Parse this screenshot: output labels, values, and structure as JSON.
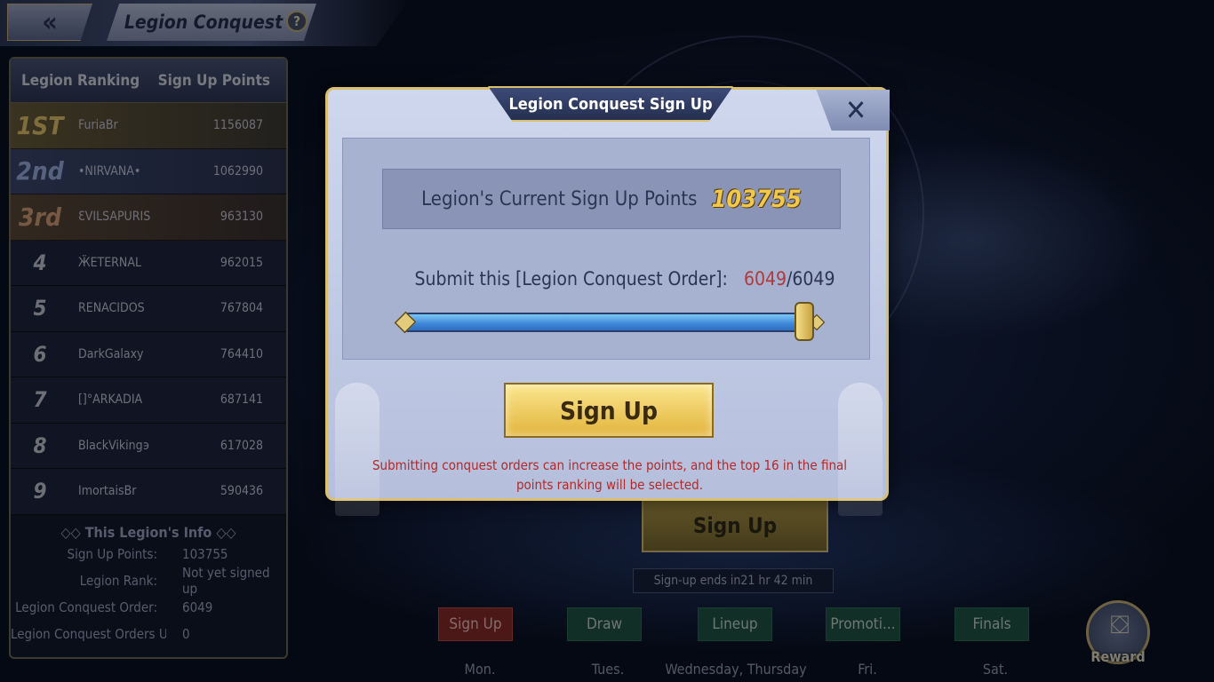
{
  "header": {
    "title": "Legion Conquest",
    "back_icon": "«",
    "help_icon": "?"
  },
  "ranking": {
    "header_rank": "Legion Ranking",
    "header_points": "Sign Up Points",
    "rows": [
      {
        "rank": "1ST",
        "name": "FuriaBr",
        "points": "1156087"
      },
      {
        "rank": "2nd",
        "name": "•NIRVANA•",
        "points": "1062990"
      },
      {
        "rank": "3rd",
        "name": "ƐVILSAPURIS",
        "points": "963130"
      },
      {
        "rank": "4",
        "name": "ӜETERNAL",
        "points": "962015"
      },
      {
        "rank": "5",
        "name": "RENACIDOS",
        "points": "767804"
      },
      {
        "rank": "6",
        "name": "DarkGalaxy",
        "points": "764410"
      },
      {
        "rank": "7",
        "name": "[]°ARKADIA",
        "points": "687141"
      },
      {
        "rank": "8",
        "name": "BlackViking϶",
        "points": "617028"
      },
      {
        "rank": "9",
        "name": "ImortaisBr",
        "points": "590436"
      }
    ]
  },
  "legion_info": {
    "title": "This Legion's Info",
    "rows": [
      {
        "label": "Sign Up Points:",
        "value": "103755"
      },
      {
        "label": "Legion Rank:",
        "value": "Not yet signed up"
      },
      {
        "label": "Legion Conquest Order:",
        "value": "6049"
      },
      {
        "label": "Legion Conquest Orders U...",
        "value": "0"
      }
    ]
  },
  "background": {
    "signup_label": "Sign Up",
    "ends_text": "Sign-up ends in21 hr 42 min",
    "tabs": [
      {
        "label": "Sign Up",
        "day": "Mon."
      },
      {
        "label": "Draw",
        "day": "Tues."
      },
      {
        "label": "Lineup",
        "day": "Wednesday, Thursday"
      },
      {
        "label": "Promoti...",
        "day": "Fri."
      },
      {
        "label": "Finals",
        "day": "Sat."
      }
    ],
    "reward_label": "Reward",
    "reward_icon": "⛋"
  },
  "modal": {
    "title": "Legion Conquest Sign Up",
    "close_icon": "✕",
    "points_label": "Legion's Current Sign Up Points",
    "points_value": "103755",
    "order_label": "Submit this [Legion Conquest Order]:",
    "order_current": "6049",
    "order_sep": "/",
    "order_max": "6049",
    "slider_fraction": 1.0,
    "signup_label": "Sign Up",
    "note": "Submitting conquest orders can increase the points, and the top 16 in the final points ranking will be selected."
  }
}
